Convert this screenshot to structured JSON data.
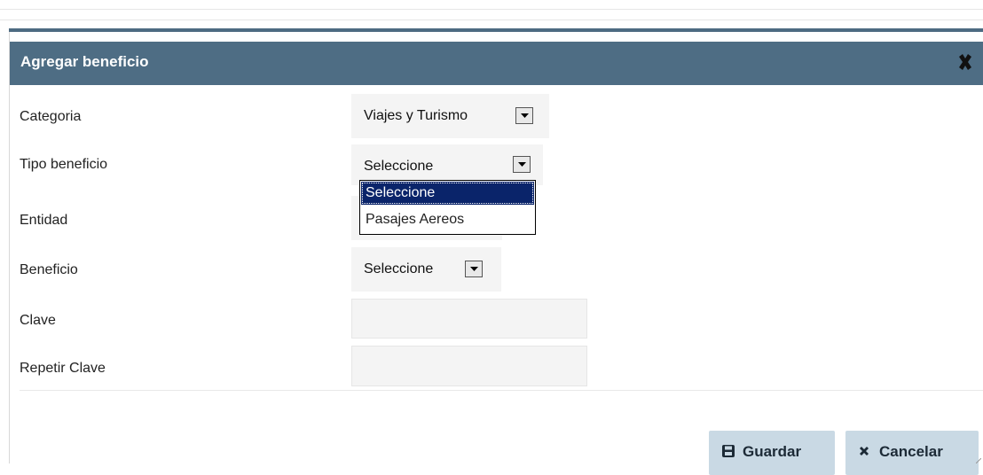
{
  "dialog": {
    "title": "Agregar beneficio",
    "close_icon": "close-x-icon"
  },
  "form": {
    "categoria": {
      "label": "Categoria",
      "value": "Viajes y Turismo"
    },
    "tipo_beneficio": {
      "label": "Tipo beneficio",
      "value": "Seleccione",
      "options": [
        "Seleccione",
        "Pasajes Aereos"
      ],
      "open": true
    },
    "entidad": {
      "label": "Entidad"
    },
    "beneficio": {
      "label": "Beneficio",
      "value": "Seleccione"
    },
    "clave": {
      "label": "Clave",
      "value": ""
    },
    "repetir_clave": {
      "label": "Repetir Clave",
      "value": ""
    }
  },
  "buttons": {
    "save": {
      "label": "Guardar",
      "icon": "floppy-disk-icon"
    },
    "cancel": {
      "label": "Cancelar",
      "icon": "x-icon"
    }
  },
  "colors": {
    "titlebar": "#4e6d84",
    "button_bg": "#c9d9e4",
    "selected_option": "#0a246a"
  }
}
